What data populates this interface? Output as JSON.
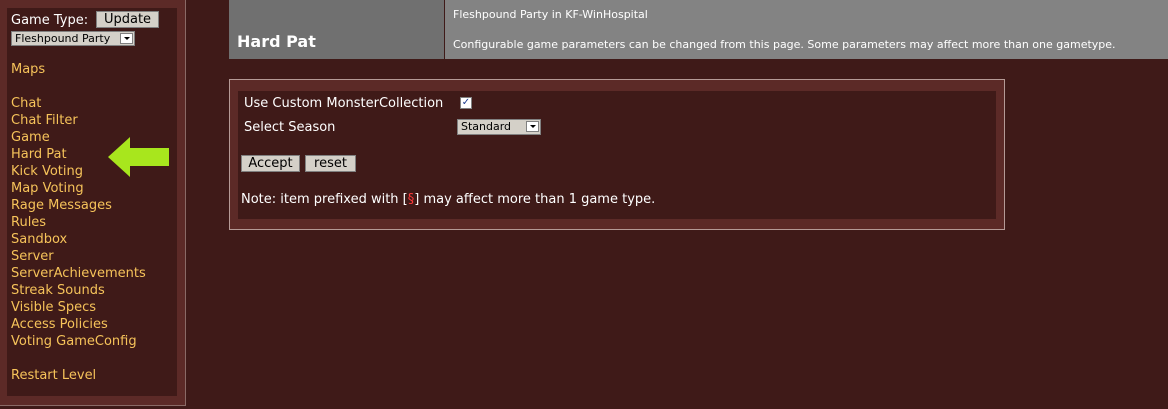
{
  "sidebar": {
    "game_type_label": "Game Type:",
    "update_button": "Update",
    "game_type_selected": "Fleshpound Party",
    "links": [
      "Maps",
      "Chat",
      "Chat Filter",
      "Game",
      "Hard Pat",
      "Kick Voting",
      "Map Voting",
      "Rage Messages",
      "Rules",
      "Sandbox",
      "Server",
      "ServerAchievements",
      "Streak Sounds",
      "Visible Specs",
      "Access Policies",
      "Voting GameConfig",
      "Restart Level"
    ],
    "pointer_icon": "green-arrow-left-icon"
  },
  "header": {
    "title": "Hard Pat",
    "subtitle": "Fleshpound Party in KF-WinHospital",
    "description": "Configurable game parameters can be changed from this page. Some parameters may affect more than one gametype."
  },
  "form": {
    "custom_monster_label": "Use Custom MonsterCollection",
    "custom_monster_checked": true,
    "season_label": "Select Season",
    "season_selected": "Standard",
    "accept_button": "Accept",
    "reset_button": "reset",
    "note_prefix": "Note: item prefixed with [",
    "note_symbol": "§",
    "note_suffix": "] may affect more than 1 game type."
  },
  "colors": {
    "background": "#3f1a18",
    "panel": "#5c2a27",
    "link": "#f6c35a",
    "arrow": "#a8e61d",
    "note_symbol": "#ff3b3b"
  }
}
